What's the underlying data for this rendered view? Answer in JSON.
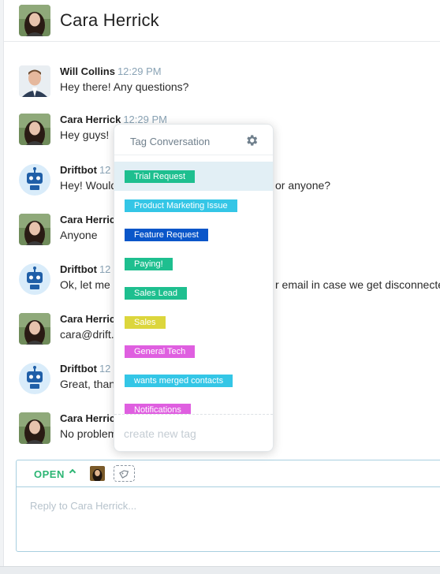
{
  "header": {
    "title": "Cara Herrick"
  },
  "messages": [
    {
      "sender": "Will Collins",
      "time": "12:29 PM",
      "text": "Hey there! Any questions?",
      "avatar": "will"
    },
    {
      "sender": "Cara Herrick",
      "time": "12:29 PM",
      "text": "Hey guys!",
      "avatar": "cara"
    },
    {
      "sender": "Driftbot",
      "time": "12",
      "text": "Hey! Would",
      "text_tail": "or anyone?",
      "avatar": "bot"
    },
    {
      "sender": "Cara Herric",
      "time": "",
      "text": "Anyone",
      "avatar": "cara"
    },
    {
      "sender": "Driftbot",
      "time": "12",
      "text": "Ok, let me",
      "text_tail": "r email in case we get disconnected",
      "avatar": "bot"
    },
    {
      "sender": "Cara Herric",
      "time": "",
      "text": "cara@drift.",
      "avatar": "cara"
    },
    {
      "sender": "Driftbot",
      "time": "12",
      "text": "Great, than",
      "avatar": "bot"
    },
    {
      "sender": "Cara Herric",
      "time": "",
      "text": "No problem",
      "avatar": "cara"
    }
  ],
  "tag_popover": {
    "title": "Tag Conversation",
    "settings_icon": "gear-icon",
    "tags": [
      {
        "label": "Trial Request",
        "color": "#1ebf8f"
      },
      {
        "label": "Product Marketing Issue",
        "color": "#34c6e6"
      },
      {
        "label": "Feature Request",
        "color": "#0a56c9"
      },
      {
        "label": "Paying!",
        "color": "#1ebf8f"
      },
      {
        "label": "Sales Lead",
        "color": "#1ebf8f"
      },
      {
        "label": "Sales",
        "color": "#dcd63c"
      },
      {
        "label": "General Tech",
        "color": "#df5fe0"
      },
      {
        "label": "wants merged contacts",
        "color": "#34c6e6"
      },
      {
        "label": "Notifications",
        "color": "#df5fe0"
      }
    ],
    "create_placeholder": "create new tag"
  },
  "composer": {
    "status": "OPEN",
    "placeholder": "Reply to Cara Herrick..."
  },
  "colors": {
    "accent_green": "#2bb573",
    "timestamp": "#8aa3b5",
    "composer_border": "#a8cfe0"
  }
}
